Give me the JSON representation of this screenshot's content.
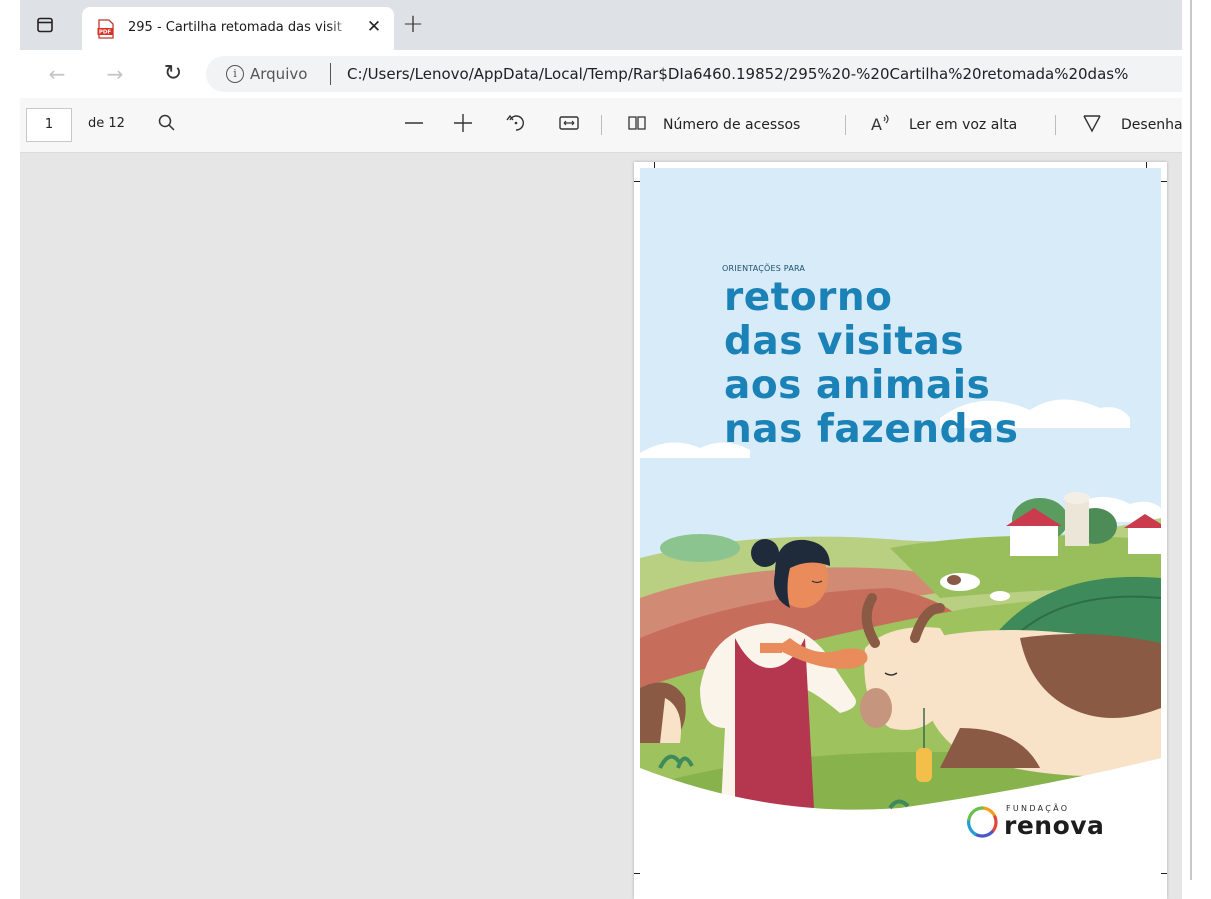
{
  "browser": {
    "tab_title": "295 - Cartilha retomada das visit",
    "address_scheme": "Arquivo",
    "url": "C:/Users/Lenovo/AppData/Local/Temp/Rar$DIa6460.19852/295%20-%20Cartilha%20retomada%20das%"
  },
  "pdf_toolbar": {
    "current_page": "1",
    "total_pages": "de 12",
    "page_view_label": "Número de acessos",
    "read_aloud_label": "Ler em voz alta",
    "draw_label": "Desenha"
  },
  "cover": {
    "subtitle": "ORIENTAÇÕES PARA",
    "title_lines": [
      "retorno",
      "das visitas",
      "aos animais",
      "nas fazendas"
    ],
    "logo_small": "FUNDAÇÃO",
    "logo_big": "renova",
    "colors": {
      "sky": "#d8ebf8",
      "title": "#1b82b7",
      "apron": "#b5364f",
      "cow": "#8a5a44"
    }
  }
}
